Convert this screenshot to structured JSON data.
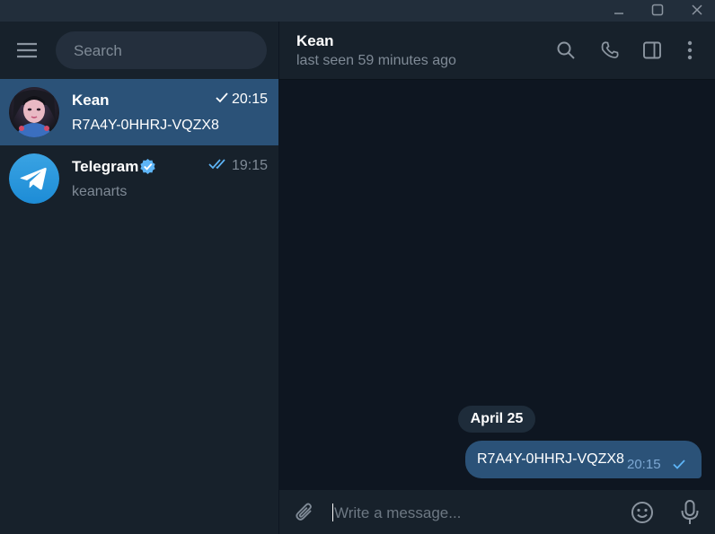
{
  "window": {
    "controls": [
      "minimize-icon",
      "maximize-icon",
      "close-icon"
    ]
  },
  "sidebar": {
    "search_placeholder": "Search",
    "chats": [
      {
        "name": "Kean",
        "time": "20:15",
        "preview": "R7A4Y-0HHRJ-VQZX8",
        "status": "sent",
        "active": true
      },
      {
        "name": "Telegram",
        "verified": true,
        "time": "19:15",
        "preview": "keanarts",
        "status": "read",
        "active": false
      }
    ]
  },
  "chat": {
    "peer_name": "Kean",
    "peer_status": "last seen 59 minutes ago",
    "header_icons": [
      "search-icon",
      "phone-icon",
      "sidebar-toggle-icon",
      "more-icon"
    ],
    "date_label": "April 25",
    "messages": [
      {
        "text": "R7A4Y-0HHRJ-VQZX8",
        "time": "20:15",
        "outgoing": true,
        "status": "sent"
      }
    ],
    "composer_placeholder": "Write a message..."
  },
  "colors": {
    "sidebar_bg": "#17212b",
    "chat_bg": "#0e1621",
    "active_item": "#2b5278",
    "bubble_out": "#2b5278",
    "accent": "#5eb5f7",
    "muted_text": "#7f8a96"
  }
}
